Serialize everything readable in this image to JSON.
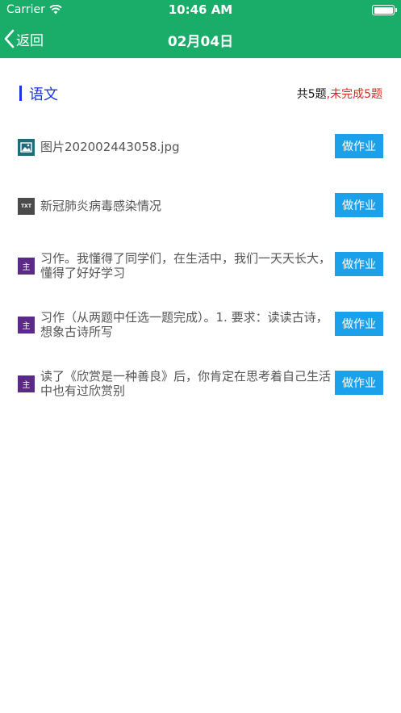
{
  "status_bar": {
    "carrier": "Carrier",
    "time": "10:46 AM",
    "icons": [
      "wifi-icon",
      "battery-icon"
    ]
  },
  "nav": {
    "back_label": "返回",
    "title": "02月04日",
    "icons": [
      "chevron-left-icon"
    ]
  },
  "subject": {
    "name": "语文",
    "total": "共5题",
    "separator": ",",
    "pending": "未完成5题"
  },
  "items": [
    {
      "icon": "image-file-icon",
      "title": "图片202002443058.jpg",
      "button": "做作业"
    },
    {
      "icon": "txt-file-icon",
      "title": "新冠肺炎病毒感染情况",
      "button": "做作业"
    },
    {
      "icon": "subjective-question-icon",
      "icon_text": "主",
      "title": "习作。我懂得了同学们，在生活中，我们一天天长大，懂得了好好学习",
      "button": "做作业"
    },
    {
      "icon": "subjective-question-icon",
      "icon_text": "主",
      "title": "习作（从两题中任选一题完成）。1. 要求：读读古诗，想象古诗所写",
      "button": "做作业"
    },
    {
      "icon": "subjective-question-icon",
      "icon_text": "主",
      "title": "读了《欣赏是一种善良》后，你肯定在思考着自己生活中也有过欣赏别",
      "button": "做作业"
    }
  ],
  "colors": {
    "header": "#1aad6a",
    "subject_accent": "#1a35e0",
    "pending": "#e0241a",
    "button": "#1ba1e9"
  }
}
